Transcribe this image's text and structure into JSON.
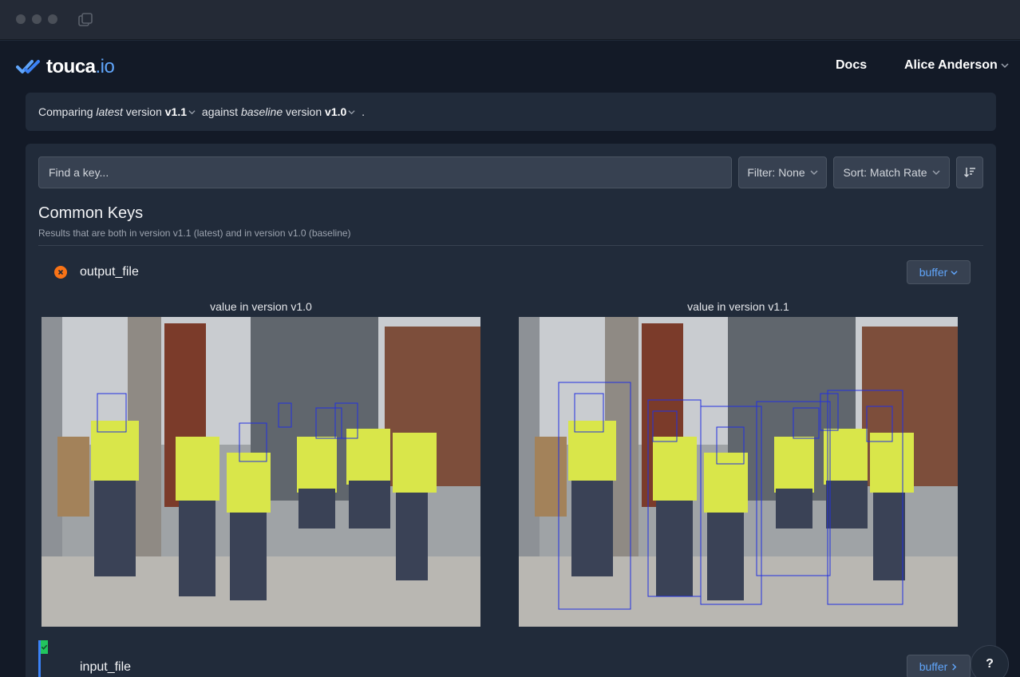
{
  "header": {
    "brand_main": "touca",
    "brand_tld": ".io",
    "docs_label": "Docs",
    "user_name": "Alice Anderson"
  },
  "compare": {
    "prefix": "Comparing ",
    "latest_word": "latest",
    "version_word": " version ",
    "latest_version": "v1.1",
    "against_word": " against ",
    "baseline_word": "baseline",
    "version_word2": " version ",
    "baseline_version": "v1.0",
    "suffix": " ."
  },
  "toolbar": {
    "search_placeholder": "Find a key...",
    "filter_label": "Filter: None",
    "sort_label": "Sort: Match Rate"
  },
  "section": {
    "title": "Common Keys",
    "subtitle": "Results that are both in version v1.1 (latest) and in version v1.0 (baseline)"
  },
  "keys": [
    {
      "name": "output_file",
      "status": "mismatch",
      "status_color": "#f97316",
      "type_label": "buffer",
      "left_label": "value in version v1.0",
      "right_label": "value in version v1.1"
    },
    {
      "name": "input_file",
      "status": "match",
      "status_color": "#22c55e",
      "type_label": "buffer"
    }
  ],
  "help_label": "?",
  "colors": {
    "accent": "#60a5fa",
    "panel": "#212b3a",
    "background": "#131a27",
    "box": "#2230e0"
  }
}
